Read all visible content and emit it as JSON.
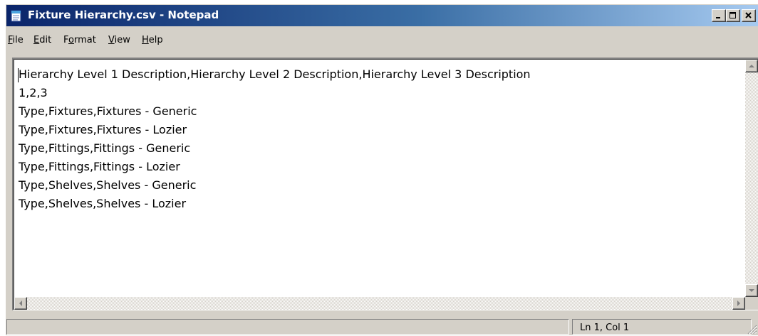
{
  "window": {
    "title": "Fixture Hierarchy.csv - Notepad",
    "app_icon": "notepad-icon",
    "controls": [
      "minimize-icon",
      "maximize-icon",
      "close-icon"
    ]
  },
  "menu": {
    "items": [
      {
        "label": "File",
        "mnemonic": "F",
        "rest": "ile"
      },
      {
        "label": "Edit",
        "mnemonic": "E",
        "rest": "dit"
      },
      {
        "label": "Format",
        "pre": "F",
        "mnemonic": "o",
        "rest": "rmat"
      },
      {
        "label": "View",
        "mnemonic": "V",
        "rest": "iew"
      },
      {
        "label": "Help",
        "mnemonic": "H",
        "rest": "elp"
      }
    ]
  },
  "editor": {
    "lines": [
      "Hierarchy Level 1 Description,Hierarchy Level 2 Description,Hierarchy Level 3 Description",
      "1,2,3",
      "Type,Fixtures,Fixtures - Generic",
      "Type,Fixtures,Fixtures - Lozier",
      "Type,Fittings,Fittings - Generic",
      "Type,Fittings,Fittings - Lozier",
      "Type,Shelves,Shelves - Generic",
      "Type,Shelves,Shelves - Lozier"
    ]
  },
  "status": {
    "position": "Ln 1, Col 1"
  },
  "colors": {
    "titlebar_start": "#0a246a",
    "titlebar_end": "#a6caf0",
    "chrome": "#d4d0c8"
  }
}
